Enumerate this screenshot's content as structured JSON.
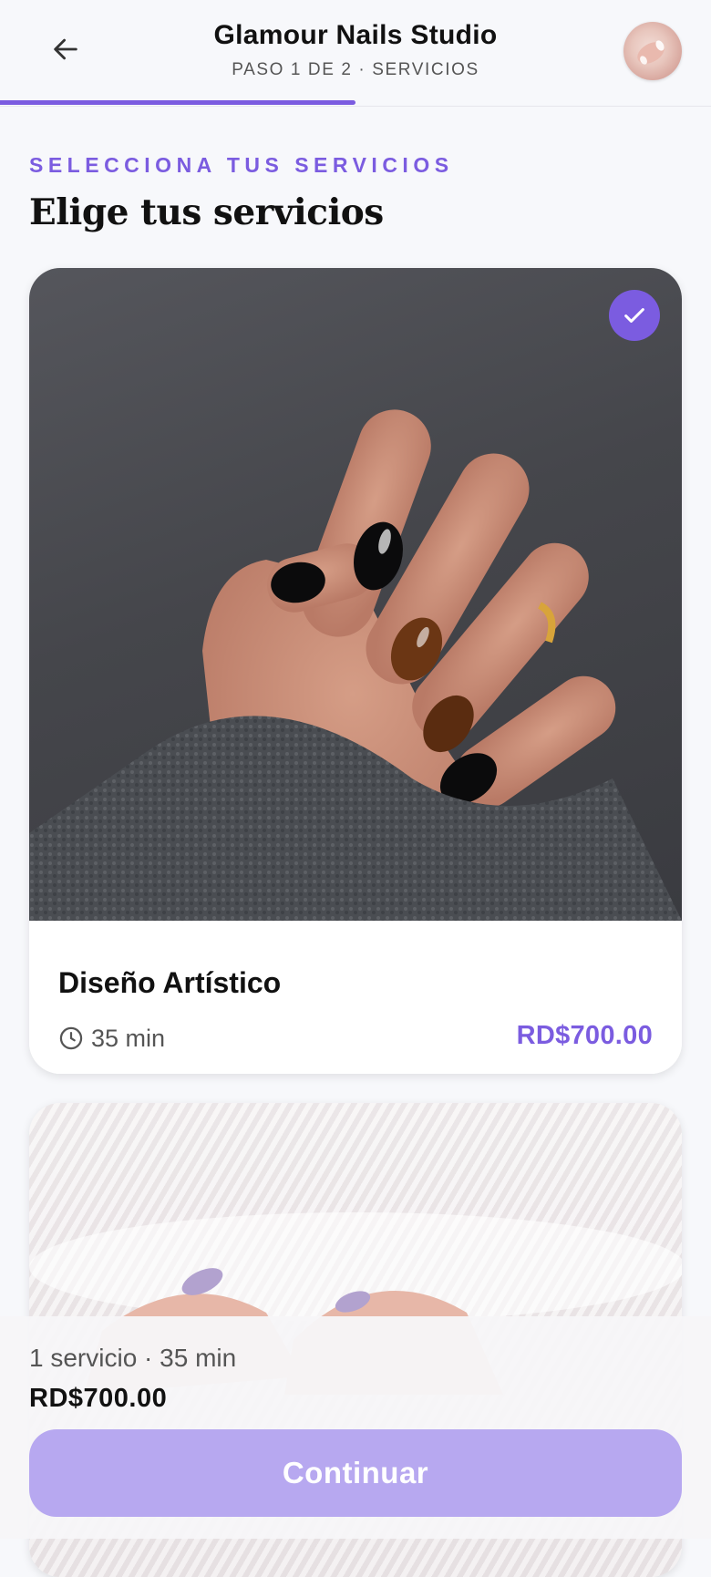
{
  "header": {
    "title": "Glamour Nails Studio",
    "subtitle": "PASO 1 DE 2 · SERVICIOS",
    "progress_percent": 50
  },
  "section": {
    "eyebrow": "SELECCIONA TUS SERVICIOS",
    "heading": "Elige tus servicios"
  },
  "services": [
    {
      "name": "Diseño Artístico",
      "duration": "35 min",
      "price": "RD$700.00",
      "selected": true
    }
  ],
  "footer": {
    "summary": "1 servicio · 35 min",
    "total": "RD$700.00",
    "button_label": "Continuar"
  },
  "colors": {
    "accent": "#7b5ce0",
    "button_disabled": "#b7a8f0",
    "background": "#f7f8fb"
  }
}
